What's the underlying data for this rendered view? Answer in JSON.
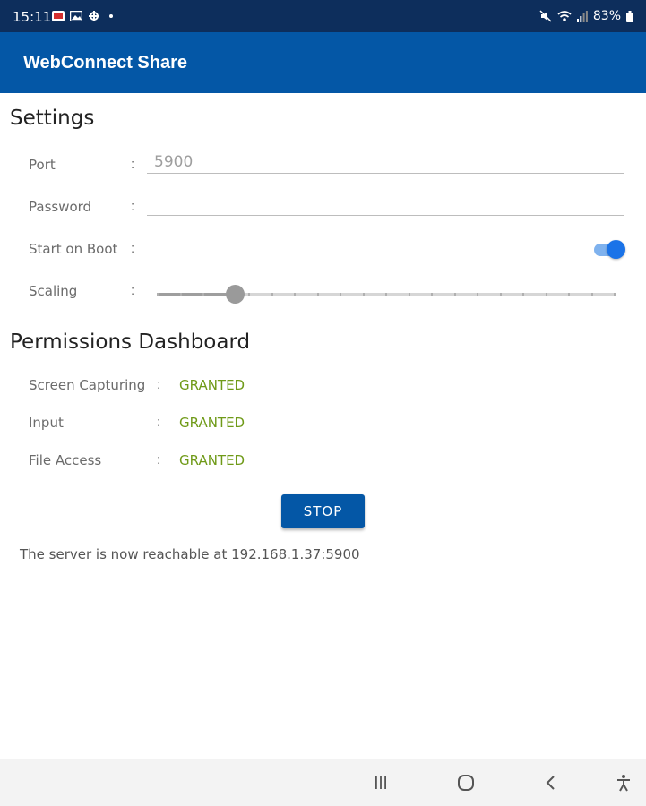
{
  "status_bar": {
    "time": "15:11",
    "battery": "83%"
  },
  "app_bar": {
    "title": "WebConnect Share"
  },
  "settings": {
    "title": "Settings",
    "port": {
      "label": "Port",
      "separator": ":",
      "placeholder": "5900",
      "value": ""
    },
    "password": {
      "label": "Password",
      "separator": ":",
      "value": ""
    },
    "start_on_boot": {
      "label": "Start on Boot",
      "separator": ":",
      "enabled": true
    },
    "scaling": {
      "label": "Scaling",
      "separator": ":",
      "level": 0.17,
      "steps": 20
    }
  },
  "permissions": {
    "title": "Permissions Dashboard",
    "items": [
      {
        "label": "Screen Capturing",
        "separator": ":",
        "status": "GRANTED"
      },
      {
        "label": "Input",
        "separator": ":",
        "status": "GRANTED"
      },
      {
        "label": "File Access",
        "separator": ":",
        "status": "GRANTED"
      }
    ]
  },
  "actions": {
    "stop_label": "STOP"
  },
  "server_message": "The server is now reachable at 192.168.1.37:5900",
  "colors": {
    "status_bar": "#0d2e5c",
    "app_bar": "#0457a6",
    "granted": "#6f9a18",
    "toggle_on": "#1a73e8"
  },
  "icons": {
    "status_left": [
      "notification-icon",
      "gallery-icon",
      "settings-icon"
    ],
    "status_right": [
      "mute-icon",
      "wifi-icon",
      "signal-icon",
      "battery-icon"
    ],
    "nav": [
      "recent-apps-icon",
      "home-icon",
      "back-icon",
      "accessibility-icon"
    ]
  }
}
